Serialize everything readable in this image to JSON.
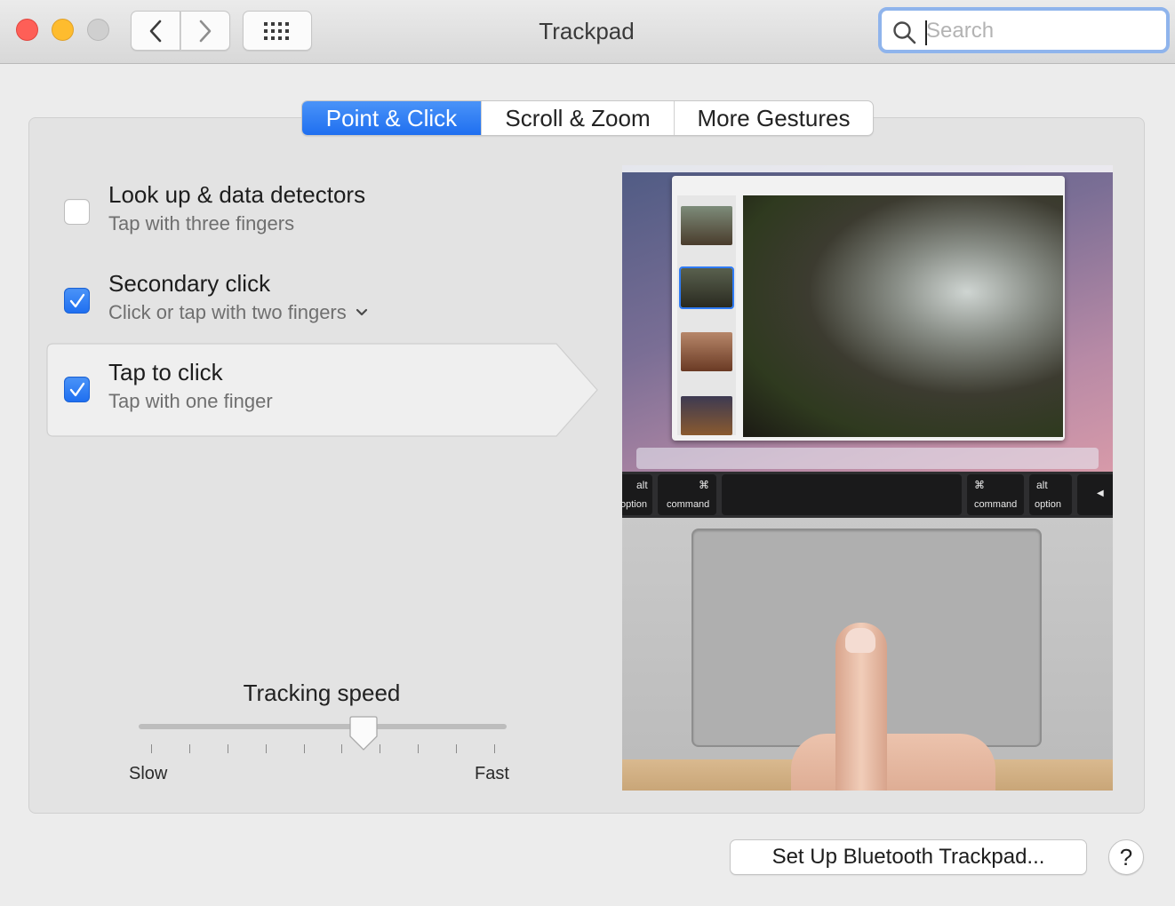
{
  "window": {
    "title": "Trackpad"
  },
  "search": {
    "placeholder": "Search",
    "value": ""
  },
  "tabs": [
    {
      "label": "Point & Click",
      "active": true
    },
    {
      "label": "Scroll & Zoom",
      "active": false
    },
    {
      "label": "More Gestures",
      "active": false
    }
  ],
  "options": [
    {
      "title": "Look up & data detectors",
      "subtitle": "Tap with three fingers",
      "checked": false
    },
    {
      "title": "Secondary click",
      "subtitle": "Click or tap with two fingers",
      "checked": true
    },
    {
      "title": "Tap to click",
      "subtitle": "Tap with one finger",
      "checked": true
    }
  ],
  "tracking": {
    "label": "Tracking speed",
    "min_label": "Slow",
    "max_label": "Fast",
    "level_fraction": 0.62,
    "tick_count": 10
  },
  "preview_keys": {
    "option_left": "option",
    "alt_left": "alt",
    "command_left": "command",
    "command_symbol": "⌘",
    "command_right": "command",
    "alt_right": "alt",
    "option_right": "option"
  },
  "bluetooth_button": {
    "label": "Set Up Bluetooth Trackpad..."
  },
  "help_button": {
    "label": "?"
  },
  "colors": {
    "accent": "#1f6ff0",
    "close": "#fe5f57",
    "minimize": "#febc2e"
  }
}
